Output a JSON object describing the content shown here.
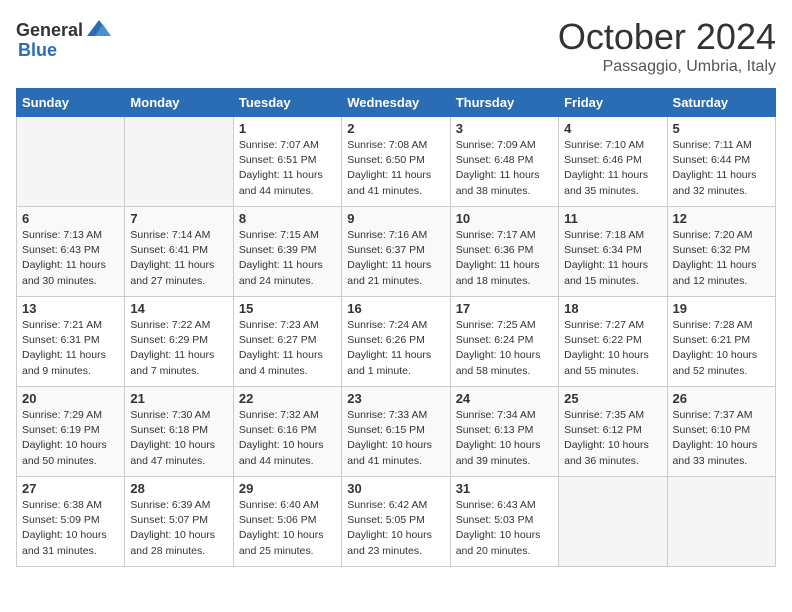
{
  "header": {
    "logo_general": "General",
    "logo_blue": "Blue",
    "month": "October 2024",
    "location": "Passaggio, Umbria, Italy"
  },
  "days_of_week": [
    "Sunday",
    "Monday",
    "Tuesday",
    "Wednesday",
    "Thursday",
    "Friday",
    "Saturday"
  ],
  "weeks": [
    [
      {
        "num": "",
        "data": ""
      },
      {
        "num": "",
        "data": ""
      },
      {
        "num": "1",
        "sunrise": "7:07 AM",
        "sunset": "6:51 PM",
        "daylight": "11 hours and 44 minutes."
      },
      {
        "num": "2",
        "sunrise": "7:08 AM",
        "sunset": "6:50 PM",
        "daylight": "11 hours and 41 minutes."
      },
      {
        "num": "3",
        "sunrise": "7:09 AM",
        "sunset": "6:48 PM",
        "daylight": "11 hours and 38 minutes."
      },
      {
        "num": "4",
        "sunrise": "7:10 AM",
        "sunset": "6:46 PM",
        "daylight": "11 hours and 35 minutes."
      },
      {
        "num": "5",
        "sunrise": "7:11 AM",
        "sunset": "6:44 PM",
        "daylight": "11 hours and 32 minutes."
      }
    ],
    [
      {
        "num": "6",
        "sunrise": "7:13 AM",
        "sunset": "6:43 PM",
        "daylight": "11 hours and 30 minutes."
      },
      {
        "num": "7",
        "sunrise": "7:14 AM",
        "sunset": "6:41 PM",
        "daylight": "11 hours and 27 minutes."
      },
      {
        "num": "8",
        "sunrise": "7:15 AM",
        "sunset": "6:39 PM",
        "daylight": "11 hours and 24 minutes."
      },
      {
        "num": "9",
        "sunrise": "7:16 AM",
        "sunset": "6:37 PM",
        "daylight": "11 hours and 21 minutes."
      },
      {
        "num": "10",
        "sunrise": "7:17 AM",
        "sunset": "6:36 PM",
        "daylight": "11 hours and 18 minutes."
      },
      {
        "num": "11",
        "sunrise": "7:18 AM",
        "sunset": "6:34 PM",
        "daylight": "11 hours and 15 minutes."
      },
      {
        "num": "12",
        "sunrise": "7:20 AM",
        "sunset": "6:32 PM",
        "daylight": "11 hours and 12 minutes."
      }
    ],
    [
      {
        "num": "13",
        "sunrise": "7:21 AM",
        "sunset": "6:31 PM",
        "daylight": "11 hours and 9 minutes."
      },
      {
        "num": "14",
        "sunrise": "7:22 AM",
        "sunset": "6:29 PM",
        "daylight": "11 hours and 7 minutes."
      },
      {
        "num": "15",
        "sunrise": "7:23 AM",
        "sunset": "6:27 PM",
        "daylight": "11 hours and 4 minutes."
      },
      {
        "num": "16",
        "sunrise": "7:24 AM",
        "sunset": "6:26 PM",
        "daylight": "11 hours and 1 minute."
      },
      {
        "num": "17",
        "sunrise": "7:25 AM",
        "sunset": "6:24 PM",
        "daylight": "10 hours and 58 minutes."
      },
      {
        "num": "18",
        "sunrise": "7:27 AM",
        "sunset": "6:22 PM",
        "daylight": "10 hours and 55 minutes."
      },
      {
        "num": "19",
        "sunrise": "7:28 AM",
        "sunset": "6:21 PM",
        "daylight": "10 hours and 52 minutes."
      }
    ],
    [
      {
        "num": "20",
        "sunrise": "7:29 AM",
        "sunset": "6:19 PM",
        "daylight": "10 hours and 50 minutes."
      },
      {
        "num": "21",
        "sunrise": "7:30 AM",
        "sunset": "6:18 PM",
        "daylight": "10 hours and 47 minutes."
      },
      {
        "num": "22",
        "sunrise": "7:32 AM",
        "sunset": "6:16 PM",
        "daylight": "10 hours and 44 minutes."
      },
      {
        "num": "23",
        "sunrise": "7:33 AM",
        "sunset": "6:15 PM",
        "daylight": "10 hours and 41 minutes."
      },
      {
        "num": "24",
        "sunrise": "7:34 AM",
        "sunset": "6:13 PM",
        "daylight": "10 hours and 39 minutes."
      },
      {
        "num": "25",
        "sunrise": "7:35 AM",
        "sunset": "6:12 PM",
        "daylight": "10 hours and 36 minutes."
      },
      {
        "num": "26",
        "sunrise": "7:37 AM",
        "sunset": "6:10 PM",
        "daylight": "10 hours and 33 minutes."
      }
    ],
    [
      {
        "num": "27",
        "sunrise": "6:38 AM",
        "sunset": "5:09 PM",
        "daylight": "10 hours and 31 minutes."
      },
      {
        "num": "28",
        "sunrise": "6:39 AM",
        "sunset": "5:07 PM",
        "daylight": "10 hours and 28 minutes."
      },
      {
        "num": "29",
        "sunrise": "6:40 AM",
        "sunset": "5:06 PM",
        "daylight": "10 hours and 25 minutes."
      },
      {
        "num": "30",
        "sunrise": "6:42 AM",
        "sunset": "5:05 PM",
        "daylight": "10 hours and 23 minutes."
      },
      {
        "num": "31",
        "sunrise": "6:43 AM",
        "sunset": "5:03 PM",
        "daylight": "10 hours and 20 minutes."
      },
      {
        "num": "",
        "data": ""
      },
      {
        "num": "",
        "data": ""
      }
    ]
  ]
}
